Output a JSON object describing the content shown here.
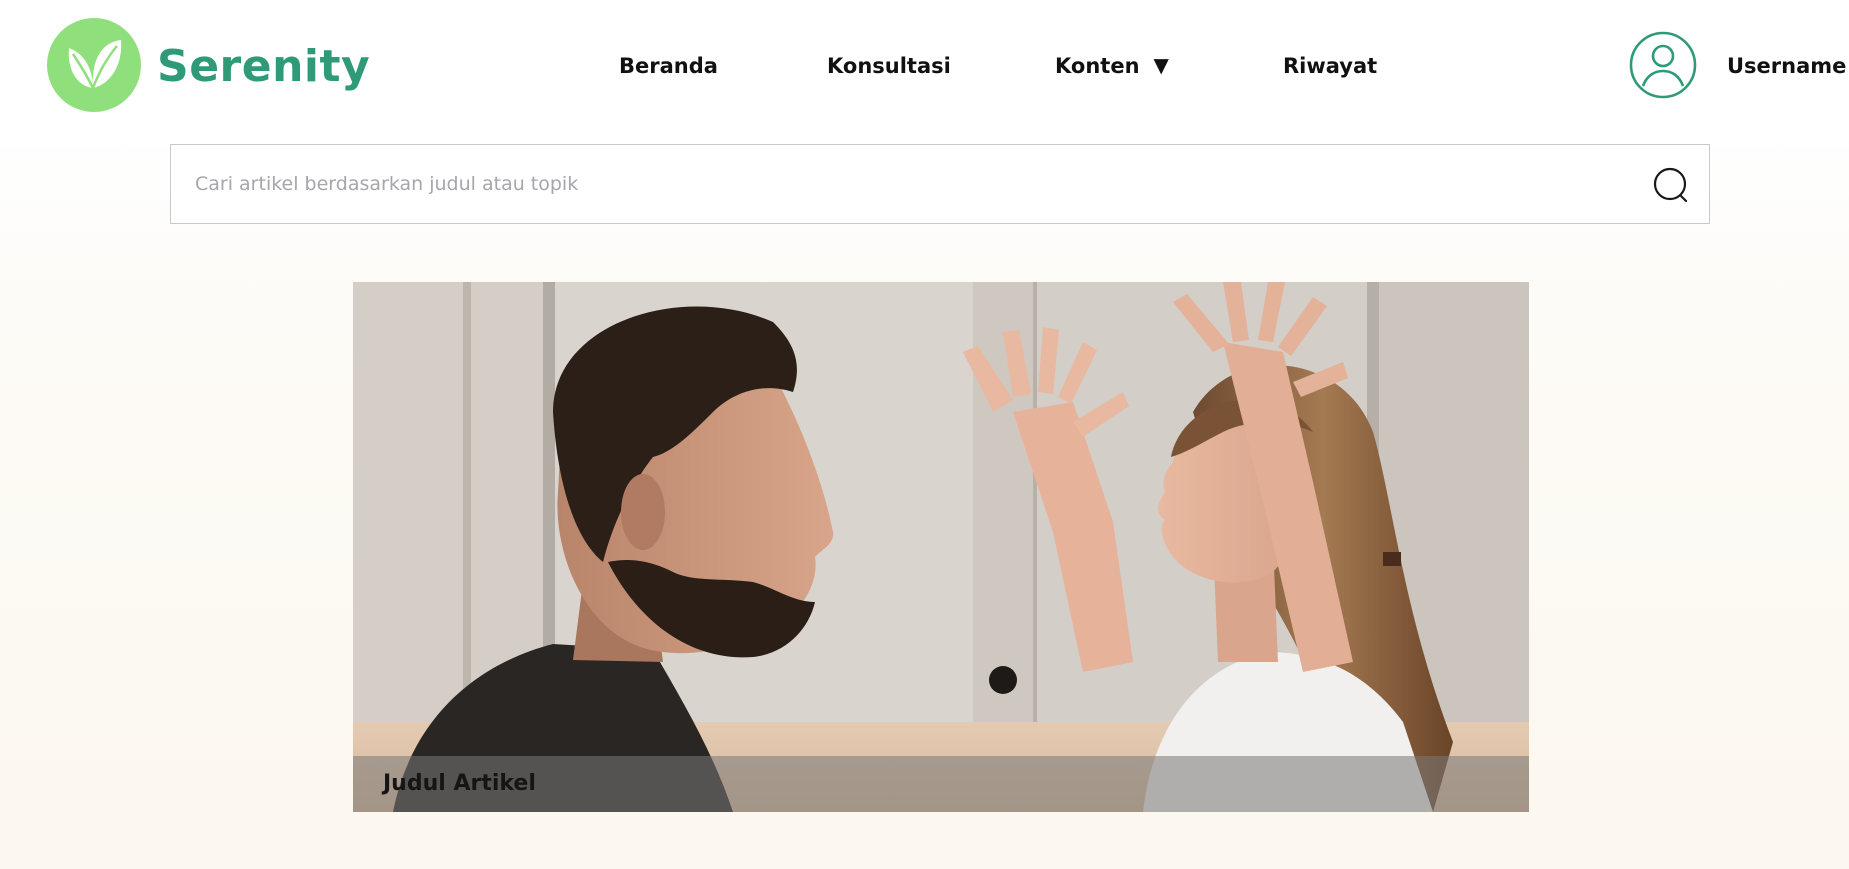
{
  "brand": {
    "name": "Serenity",
    "logo_icon": "leaf-icon",
    "logo_bg_color": "#8fe07c",
    "text_color": "#2e9a78"
  },
  "nav": {
    "items": [
      {
        "label": "Beranda"
      },
      {
        "label": "Konsultasi"
      },
      {
        "label": "Konten",
        "caret": "▼"
      },
      {
        "label": "Riwayat"
      }
    ]
  },
  "user": {
    "name": "Username",
    "avatar_icon": "user-circle-icon",
    "avatar_color": "#2e9a78"
  },
  "search": {
    "placeholder": "Cari artikel berdasarkan judul atau topik",
    "value": "",
    "icon": "search-icon"
  },
  "article": {
    "title": "Judul Artikel",
    "image_description_icon": "article-photo"
  }
}
